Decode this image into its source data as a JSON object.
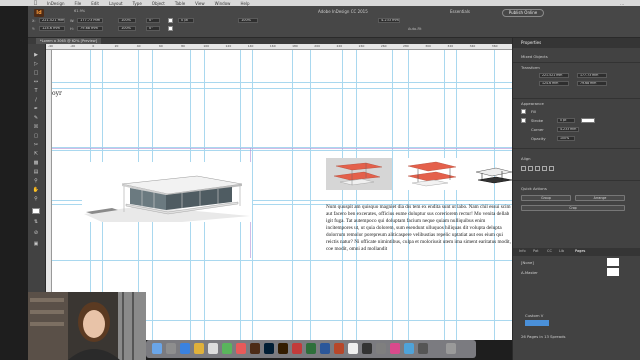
{
  "menubar": {
    "items": [
      "InDesign",
      "File",
      "Edit",
      "Layout",
      "Type",
      "Object",
      "Table",
      "View",
      "Window",
      "Help"
    ],
    "right": "..."
  },
  "app": {
    "logo": "Id",
    "title": "Adobe InDesign CC 2015",
    "zoom": "61.9%",
    "workspace": "Essentials",
    "publish_label": "Publish Online"
  },
  "control": {
    "x": "221.521 mm",
    "y": "124.6 mm",
    "w": "177.73 mm",
    "h": "79.68 mm",
    "scale_x": "100%",
    "scale_y": "100%",
    "rotate": "0°",
    "shear": "0°",
    "stroke": "0 pt",
    "ref": "4.233 mm",
    "frame_pct": "100%",
    "auto_fit": "Auto-Fit"
  },
  "tab": {
    "label": "*Lorem a 3065 @ 62% [Preview]"
  },
  "ruler": {
    "ticks": [
      "-40",
      "-20",
      "0",
      "20",
      "40",
      "60",
      "80",
      "100",
      "120",
      "140",
      "160",
      "180",
      "200",
      "220",
      "240",
      "260",
      "280",
      "300",
      "320",
      "340",
      "360"
    ]
  },
  "canvas": {
    "snippet": "oyr",
    "body_text": "Num quuspit am quisquo magniet dia dis tem ex endita sunt ut labo. Nam chil essui scim aut facero ben excerates, officius eume doluptur sus coreriorem rectur! Mo venita dellab igit fuga. Tat autempoco qui doluptam facium neque quiam nulliquibus enim incitempores ut, ut quia dolorem, sum esendunt ulluquos hiliquas dit volupta delupta dolorrum remolor porepreum aliticaspere velibustias repelic uptatiat aut eos eium qui reictis natur? Ni officate nimintibus, culpa et moloriusit utem ima siment earitatus modit, coe modit, omni ad mollandit"
  },
  "panel": {
    "tab_label": "Properties",
    "section_selected": "Mixed Objects",
    "transform_header": "Transform",
    "t_x": "221.521 mm",
    "t_y": "124.6 mm",
    "t_w": "177.73 mm",
    "t_h": "79.68 mm",
    "appearance_header": "Appearance",
    "fill_label": "Fill",
    "stroke_label": "Stroke",
    "stroke_weight": "0 pt",
    "corner_label": "Corner",
    "corner_value": "4.233 mm",
    "opacity_label": "Opacity",
    "opacity_value": "100%",
    "align_header": "Align",
    "quick_header": "Quick Actions",
    "quick_btn_1": "Group",
    "quick_btn_2": "Arrange",
    "quick_btn_3": "Crop",
    "pages_tabs": [
      "Info",
      "Pat",
      "CC",
      "Lib",
      "Pages"
    ],
    "pages_none": "[None]",
    "pages_master": "A-Master",
    "layer_label": "Custom V",
    "status": "26 Pages in 13 Spreads"
  },
  "colors": {
    "accent": "#f89a3b",
    "guide": "#a9d8ef",
    "margin": "#b38fd6",
    "roof_red": "#e4604b"
  }
}
